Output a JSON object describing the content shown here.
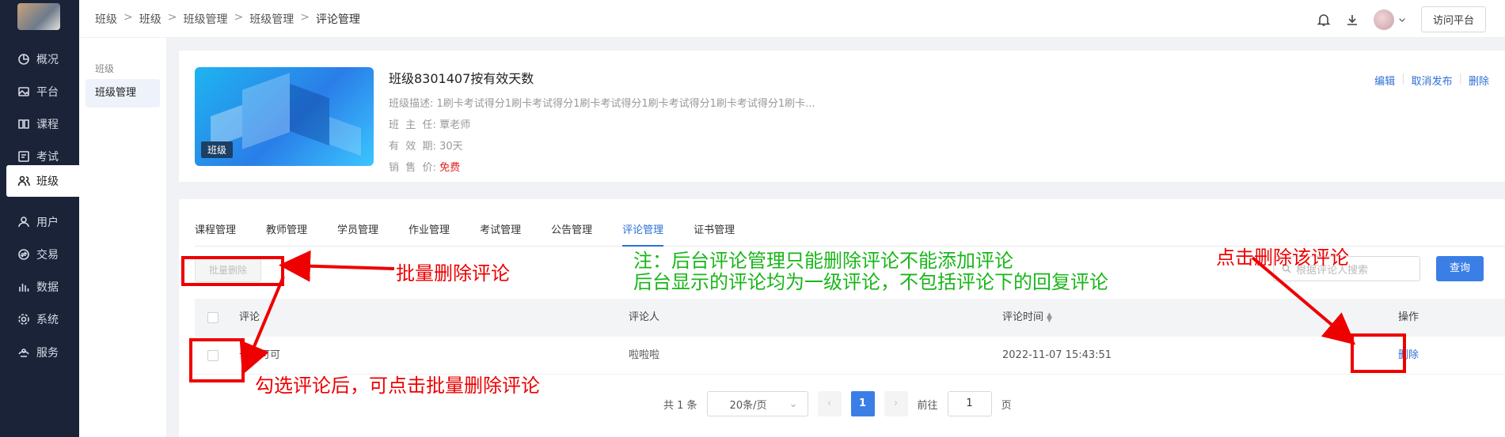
{
  "sidebar": {
    "items": [
      {
        "label": "概况",
        "icon": "pie-chart-icon"
      },
      {
        "label": "平台",
        "icon": "image-icon"
      },
      {
        "label": "课程",
        "icon": "book-icon"
      },
      {
        "label": "考试",
        "icon": "monitor-icon"
      },
      {
        "label": "班级",
        "icon": "users-icon"
      },
      {
        "label": "用户",
        "icon": "user-icon"
      },
      {
        "label": "交易",
        "icon": "exchange-icon"
      },
      {
        "label": "数据",
        "icon": "bar-chart-icon"
      },
      {
        "label": "系统",
        "icon": "gear-icon"
      },
      {
        "label": "服务",
        "icon": "service-icon"
      }
    ]
  },
  "breadcrumb": [
    "班级",
    "班级",
    "班级管理",
    "班级管理",
    "评论管理"
  ],
  "topbar": {
    "visit_label": "访问平台"
  },
  "subnav": {
    "group": "班级",
    "item": "班级管理"
  },
  "class_card": {
    "cover_tag": "班级",
    "title": "班级8301407按有效天数",
    "desc_label": "班级描述:",
    "desc_value": "1刷卡考试得分1刷卡考试得分1刷卡考试得分1刷卡考试得分1刷卡考试得分1刷卡...",
    "teacher_label": "班  主  任:",
    "teacher_value": "覃老师",
    "period_label": "有  效  期:",
    "period_value": "30天",
    "price_label": "销  售  价:",
    "price_value": "免费",
    "actions": [
      "编辑",
      "取消发布",
      "删除"
    ]
  },
  "tabs": [
    {
      "label": "课程管理"
    },
    {
      "label": "教师管理"
    },
    {
      "label": "学员管理"
    },
    {
      "label": "作业管理"
    },
    {
      "label": "考试管理"
    },
    {
      "label": "公告管理"
    },
    {
      "label": "评论管理"
    },
    {
      "label": "证书管理"
    }
  ],
  "toolbar": {
    "bulk_delete": "批量删除",
    "search_placeholder": "根据评论人搜索",
    "query": "查询"
  },
  "table": {
    "headers": {
      "comment": "评论",
      "commenter": "评论人",
      "time": "评论时间",
      "action": "操作"
    },
    "rows": [
      {
        "comment": "卡卡可可",
        "commenter": "啦啦啦",
        "time": "2022-11-07 15:43:51",
        "action": "删除"
      }
    ]
  },
  "pagination": {
    "total": "共 1 条",
    "page_size": "20条/页",
    "current": "1",
    "goto_label": "前往",
    "goto_value": "1",
    "page_suffix": "页"
  },
  "annotations": {
    "bulk_delete": "批量删除评论",
    "note_line1": "注：后台评论管理只能删除评论不能添加评论",
    "note_line2": "后台显示的评论均为一级评论，不包括评论下的回复评论",
    "click_delete": "点击删除该评论",
    "check_tip": "勾选评论后，可点击批量删除评论"
  },
  "colors": {
    "accent": "#3b7fe6",
    "sidebar": "#1b2338",
    "annotation_red": "#ee0000",
    "annotation_green": "#18b618"
  }
}
